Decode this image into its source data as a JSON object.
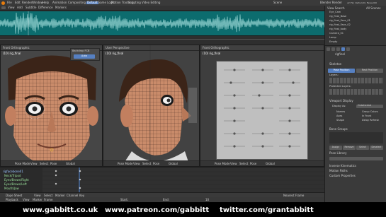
{
  "menu": {
    "items": [
      "File",
      "Edit",
      "Render",
      "Window",
      "Help"
    ],
    "workspaces": [
      "Animation",
      "Compositing",
      "Default",
      "Game Logic",
      "Motion Tracking",
      "Scripting",
      "Video Editing"
    ],
    "scene": "Scene",
    "engine": "Blender Render",
    "stats": "v2.79 | Verts:1/0 | Faces:0/0"
  },
  "tabs": [
    "View",
    "Add",
    "Subtitle",
    "Difference",
    "Markers"
  ],
  "viewports": [
    {
      "title": "Front Orthographic",
      "object": "(10) rig_final",
      "panel_title": "Backdrop FCB",
      "panel_btn": "Auto"
    },
    {
      "title": "User Perspective",
      "object": "(10) rig_final"
    },
    {
      "title": "Front Orthographic",
      "object": "(10) rig_final"
    }
  ],
  "viewport_footer": {
    "mode": "Pose Mode",
    "items": [
      "View",
      "Select",
      "Pose"
    ],
    "pivot": "Global"
  },
  "timeline": {
    "tracks": [
      "rigfacebone01",
      "Neck/Tripod",
      "Eyes/Brows/Right",
      "Eyes/Brows/Left",
      "Mouth/Jaw"
    ],
    "header": [
      "View",
      "Select",
      "Marker",
      "Channel",
      "Key"
    ],
    "mode": "Dope Sheet",
    "keying": "Nearest Frame"
  },
  "playback": {
    "items": [
      "Playback",
      "View",
      "Marker",
      "Frame"
    ],
    "start_label": "Start:",
    "end_label": "End:",
    "current": "10"
  },
  "outliner": {
    "header": "View Search",
    "filter": "All Scenes",
    "rows": [
      "Eye_Cam",
      "rig_final_Base",
      "rig_final_Face_01",
      "rig_final_Face_02",
      "rig_final_body",
      "Camera_01",
      "Lamp",
      "Empty"
    ]
  },
  "properties": {
    "object": "rigfinal",
    "tabs_label": "Skeleton",
    "pose_position": "Pose Position",
    "rest_position": "Rest Position",
    "layers": "Layers:",
    "protected_layers": "Protected Layers:",
    "display_section": "Viewport Display",
    "display_as": "Display As:",
    "display_value": "Octahedral",
    "checks_left": [
      "Names",
      "Axes",
      "Shape"
    ],
    "checks_right": [
      "Group Colors",
      "In Front",
      "Delay Refresh"
    ],
    "bone_groups": "Bone Groups",
    "buttons": [
      "Assign",
      "Remove",
      "Select",
      "Deselect"
    ],
    "pose_library": "Pose Library",
    "inverse_kinematics": "Inverse Kinematics",
    "motion_paths": "Motion Paths",
    "custom_properties": "Custom Properties"
  },
  "footer_urls": [
    "www.gabbitt.co.uk",
    "www.patreon.com/gabbitt",
    "twitter.com/grantabbitt"
  ],
  "colors": {
    "waveform_bg": "#0c6c6e",
    "waveform_line": "#9bd8d6",
    "accent_blue": "#5680c2",
    "skin": "#c98b6a"
  }
}
